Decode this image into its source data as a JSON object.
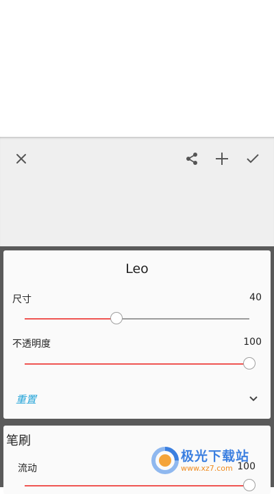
{
  "toolbar": {
    "close_icon": "close-icon",
    "share_icon": "share-icon",
    "add_icon": "plus-icon",
    "confirm_icon": "check-icon"
  },
  "panel": {
    "title": "Leo",
    "size": {
      "label": "尺寸",
      "value": "40",
      "level": 0.41
    },
    "opacity": {
      "label": "不透明度",
      "value": "100",
      "level": 1.0
    },
    "reset_label": "重置",
    "expand_icon": "chevron-down-icon"
  },
  "brush": {
    "title": "笔刷",
    "flow": {
      "label": "流动",
      "value": "100",
      "level": 1.0
    }
  },
  "watermark": {
    "name": "极光下载站",
    "url": "www.xz7.com"
  },
  "colors": {
    "accent": "#ef5350",
    "link": "#29a6d9",
    "panel_bg": "#fafafa",
    "toolbar_bg": "#efefef",
    "backdrop": "#5a5a5a"
  }
}
